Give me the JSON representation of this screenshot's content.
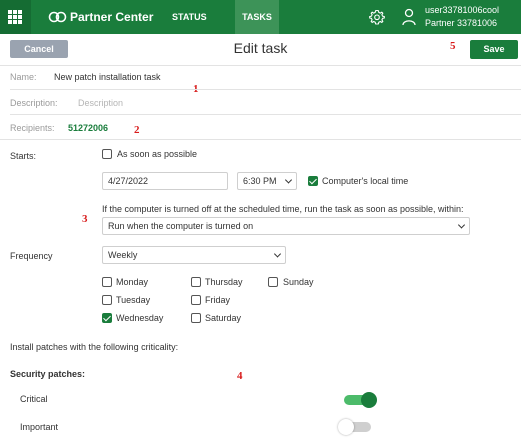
{
  "topbar": {
    "brand": "Partner Center",
    "nav": {
      "status": "STATUS",
      "tasks": "TASKS"
    },
    "user": {
      "name": "user33781006cool",
      "partner": "Partner 33781006"
    },
    "icons": [
      "waffle-menu-icon",
      "partner-center-logo",
      "gear-icon",
      "user-icon"
    ],
    "brand_color": "#1a7d3c"
  },
  "header": {
    "cancel": "Cancel",
    "title": "Edit task",
    "save": "Save"
  },
  "form": {
    "name_label": "Name:",
    "name_value": "New patch installation task",
    "description_label": "Description:",
    "description_placeholder": "Description",
    "recipients_label": "Recipients:",
    "recipients_value": "51272006",
    "starts_label": "Starts:",
    "asap_label": "As soon as possible",
    "date_value": "4/27/2022",
    "time_value": "6:30 PM",
    "local_time_label": "Computer's local time",
    "offline_note": "If the computer is turned off at the scheduled time, run the task as soon as possible, within:",
    "offline_option": "Run when the computer is turned on",
    "frequency_label": "Frequency",
    "frequency_value": "Weekly",
    "days": {
      "monday": "Monday",
      "tuesday": "Tuesday",
      "wednesday": "Wednesday",
      "thursday": "Thursday",
      "friday": "Friday",
      "saturday": "Saturday",
      "sunday": "Sunday"
    },
    "install_note": "Install patches with the following criticality:",
    "security_heading": "Security patches:",
    "critical_label": "Critical",
    "important_label": "Important"
  },
  "state": {
    "asap_checked": false,
    "local_time_checked": true,
    "wednesday_checked": true,
    "critical_on": true,
    "important_on": false
  },
  "annotations": [
    "1",
    "2",
    "3",
    "4",
    "5"
  ]
}
